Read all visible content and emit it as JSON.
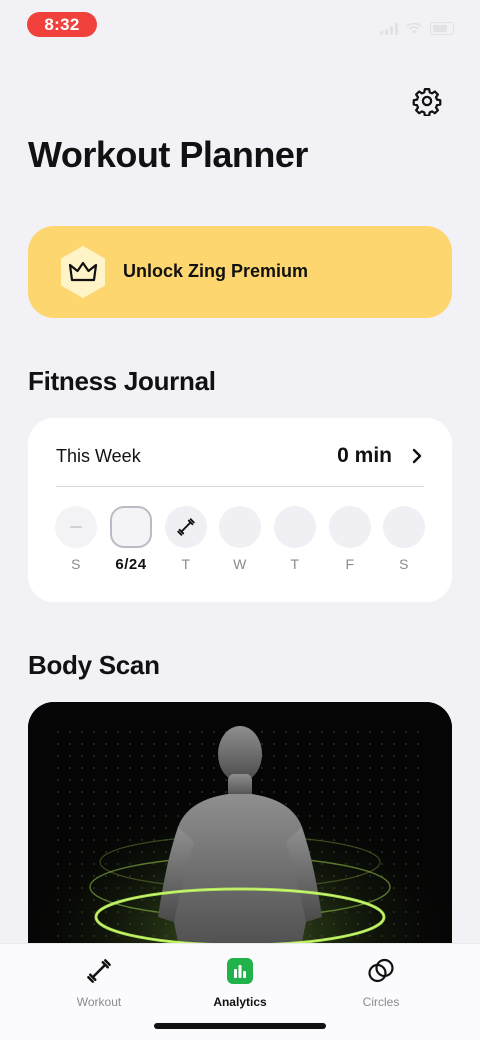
{
  "status": {
    "time": "8:32"
  },
  "header": {
    "title": "Workout Planner"
  },
  "premium": {
    "label": "Unlock Zing Premium"
  },
  "journal": {
    "section_title": "Fitness Journal",
    "week_label": "This Week",
    "week_value": "0 min",
    "days": [
      {
        "label": "S",
        "state": "rest"
      },
      {
        "label": "6/24",
        "state": "today"
      },
      {
        "label": "T",
        "state": "workout"
      },
      {
        "label": "W",
        "state": "empty"
      },
      {
        "label": "T",
        "state": "empty"
      },
      {
        "label": "F",
        "state": "empty"
      },
      {
        "label": "S",
        "state": "empty"
      }
    ]
  },
  "body_scan": {
    "section_title": "Body Scan"
  },
  "tabs": [
    {
      "label": "Workout",
      "icon": "dumbbell-icon",
      "active": false
    },
    {
      "label": "Analytics",
      "icon": "analytics-icon",
      "active": true
    },
    {
      "label": "Circles",
      "icon": "circles-icon",
      "active": false
    }
  ],
  "colors": {
    "premium_bg": "#fdd66f",
    "accent_green": "#22b24c",
    "time_pill": "#f0413c",
    "scan_ring": "#b6f15a"
  }
}
